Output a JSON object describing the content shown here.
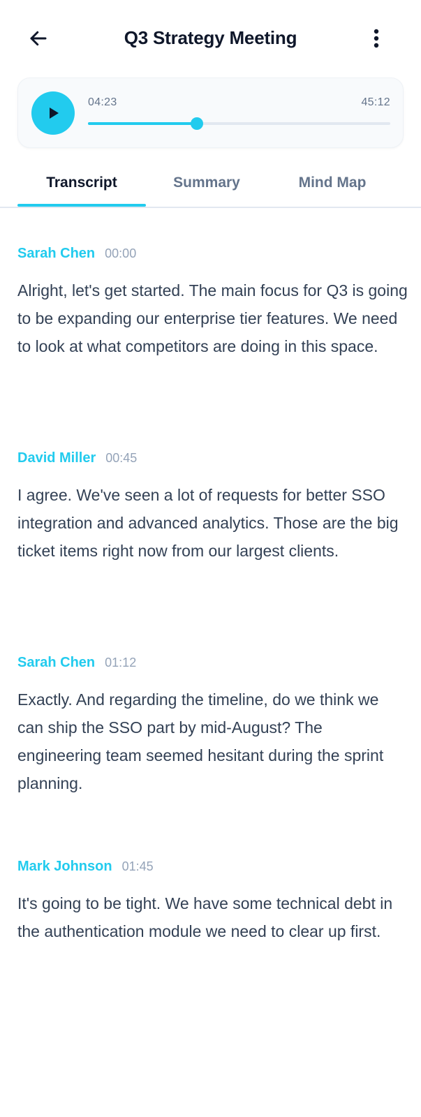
{
  "header": {
    "title": "Q3 Strategy Meeting",
    "back_icon": "arrow-left-icon",
    "menu_icon": "more-vertical-icon"
  },
  "player": {
    "play_icon": "play-icon",
    "current_time": "04:23",
    "total_time": "45:12",
    "progress": 0.36,
    "accent_color": "#22cbee"
  },
  "tabs": [
    {
      "label": "Transcript",
      "active": true
    },
    {
      "label": "Summary",
      "active": false
    },
    {
      "label": "Mind Map",
      "active": false
    }
  ],
  "transcript": [
    {
      "speaker": "Sarah Chen",
      "time": "00:00",
      "text": "Alright, let's get started. The main focus for Q3 is going to be expanding our enterprise tier features. We need to look at what competitors are doing in this space."
    },
    {
      "speaker": "David Miller",
      "time": "00:45",
      "text": "I agree. We've seen a lot of requests for better SSO integration and advanced analytics. Those are the big ticket items right now from our largest clients."
    },
    {
      "speaker": "Sarah Chen",
      "time": "01:12",
      "text": "Exactly. And regarding the timeline, do we think we can ship the SSO part by mid-August? The engineering team seemed hesitant during the sprint planning."
    },
    {
      "speaker": "Mark Johnson",
      "time": "01:45",
      "text": "It's going to be tight. We have some technical debt in the authentication module we need to clear up first."
    }
  ]
}
